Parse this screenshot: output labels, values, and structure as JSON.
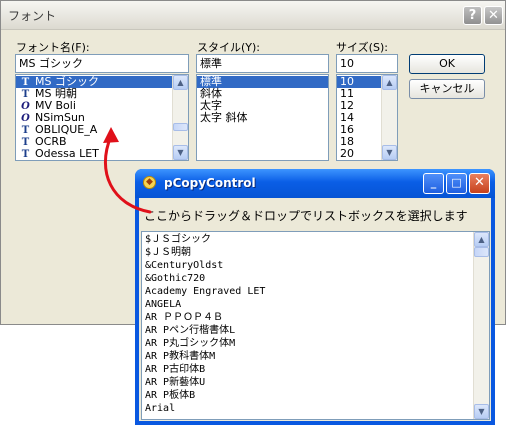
{
  "font_dialog": {
    "title": "フォント",
    "help_glyph": "?",
    "close_glyph": "✕",
    "font_label": "フォント名(F):",
    "font_value": "MS ゴシック",
    "style_label": "スタイル(Y):",
    "style_value": "標準",
    "size_label": "サイズ(S):",
    "size_value": "10",
    "ok_label": "OK",
    "cancel_label": "キャンセル",
    "font_icon_truetype": "T",
    "font_icon_opentype": "O",
    "fonts": [
      {
        "name": "MS ゴシック",
        "icon": "truetype",
        "selected": true
      },
      {
        "name": "MS 明朝",
        "icon": "truetype",
        "selected": false
      },
      {
        "name": "MV Boli",
        "icon": "opentype",
        "selected": false
      },
      {
        "name": "NSimSun",
        "icon": "opentype",
        "selected": false
      },
      {
        "name": "OBLIQUE_A",
        "icon": "truetype",
        "selected": false
      },
      {
        "name": "OCRB",
        "icon": "truetype",
        "selected": false
      },
      {
        "name": "Odessa LET",
        "icon": "truetype",
        "selected": false
      }
    ],
    "styles": [
      {
        "name": "標準",
        "selected": true
      },
      {
        "name": "斜体",
        "selected": false
      },
      {
        "name": "太字",
        "selected": false
      },
      {
        "name": "太字 斜体",
        "selected": false
      }
    ],
    "sizes": [
      {
        "name": "10",
        "selected": true
      },
      {
        "name": "11",
        "selected": false
      },
      {
        "name": "12",
        "selected": false
      },
      {
        "name": "14",
        "selected": false
      },
      {
        "name": "16",
        "selected": false
      },
      {
        "name": "18",
        "selected": false
      },
      {
        "name": "20",
        "selected": false
      }
    ]
  },
  "copy_window": {
    "title": "pCopyControl",
    "icon_glyph": "◆",
    "min_glyph": "_",
    "max_glyph": "□",
    "close_glyph": "✕",
    "instruction": "ここからドラッグ＆ドロップでリストボックスを選択します",
    "fonts": [
      "$ＪＳゴシック",
      "$ＪＳ明朝",
      "&CenturyOldst",
      "&Gothic720",
      "Academy Engraved LET",
      "ANGELA",
      "AR ＰＰＯＰ４Ｂ",
      "AR Pペン行楷書体L",
      "AR P丸ゴシック体M",
      "AR P教科書体M",
      "AR P古印体B",
      "AR P新藝体U",
      "AR P板体B",
      "Arial"
    ]
  },
  "scroll_glyphs": {
    "up": "▲",
    "down": "▼"
  },
  "colors": {
    "selection": "#316ac5",
    "titlebar": "#0a5ee6",
    "arrow": "#e0101a"
  }
}
